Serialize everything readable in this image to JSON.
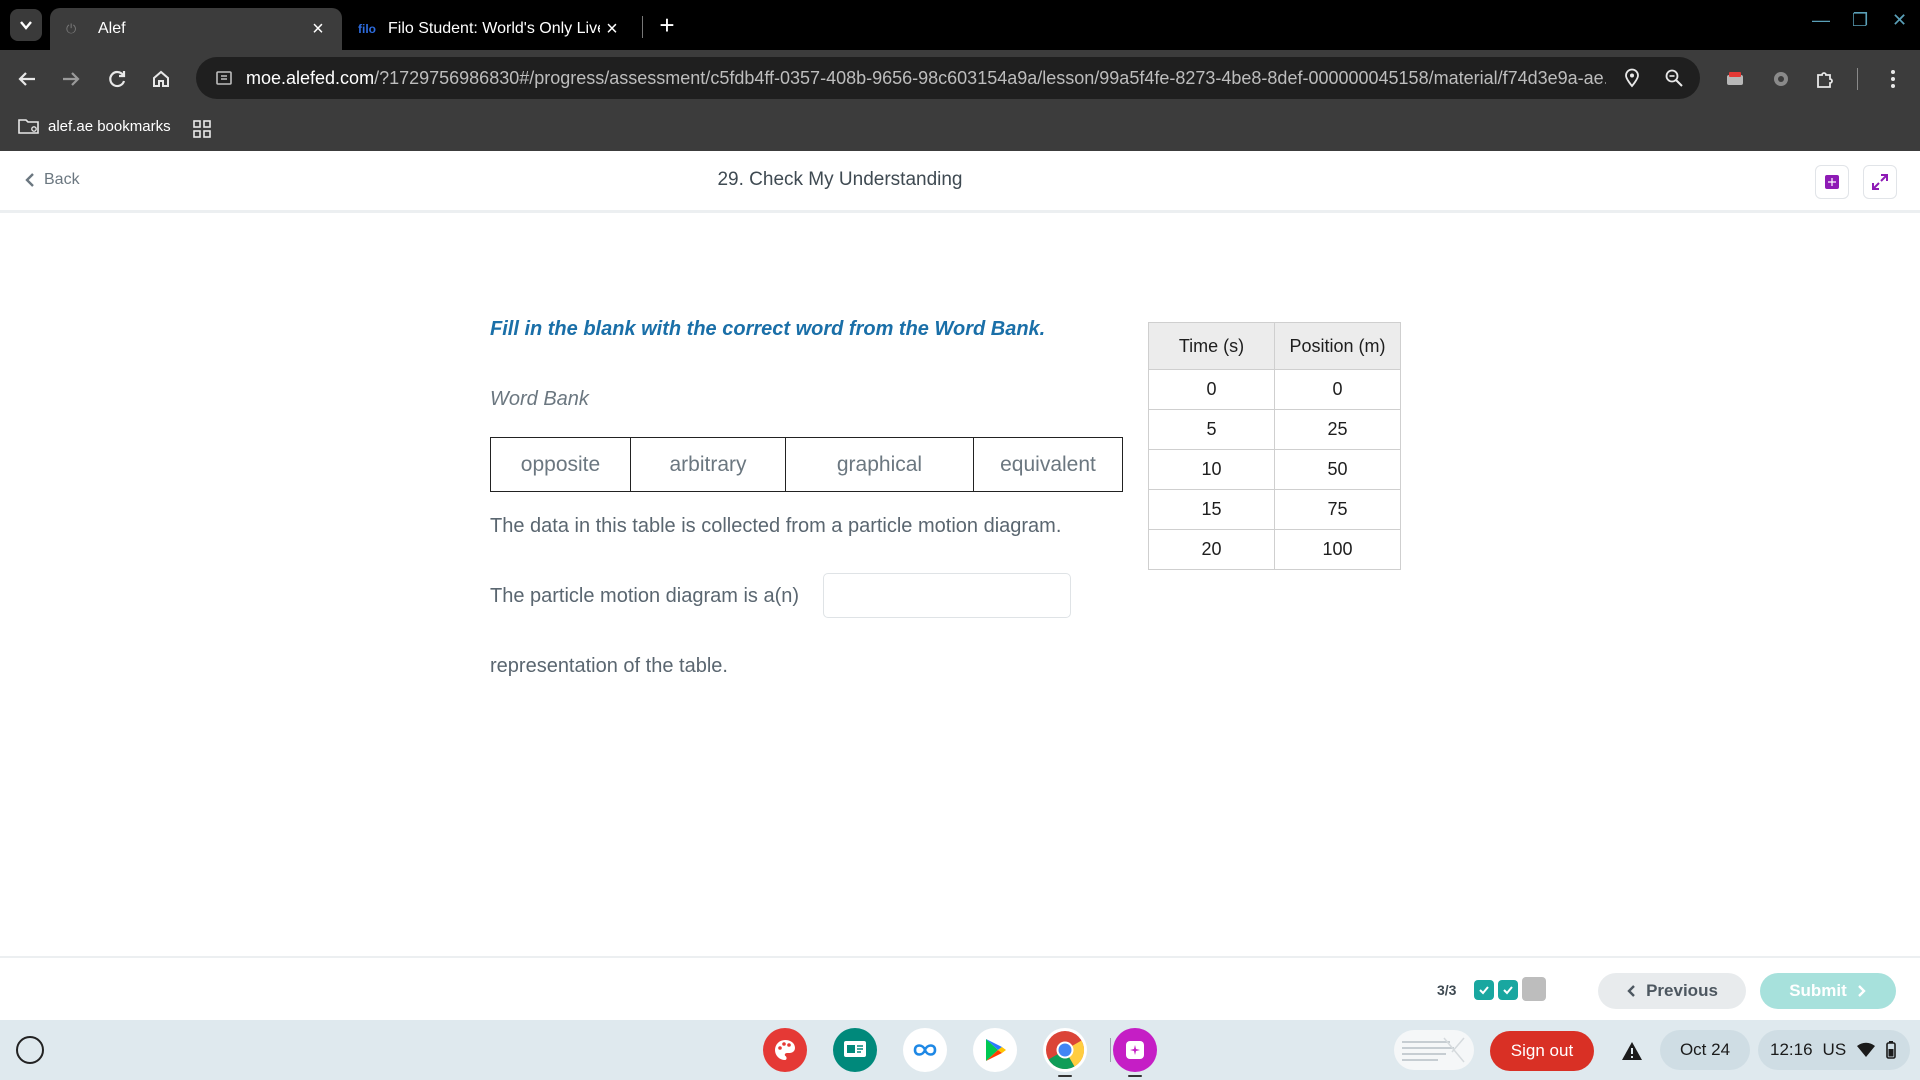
{
  "browser": {
    "tabs": [
      {
        "title": "Alef",
        "favicon": "alef-favicon",
        "active": true
      },
      {
        "title": "Filo Student: World's Only Live I",
        "favicon_text": "filo",
        "active": false
      }
    ],
    "url_host": "moe.alefed.com",
    "url_rest": "/?1729756986830#/progress/assessment/c5fdb4ff-0357-408b-9656-98c603154a9a/lesson/99a5f4fe-8273-4be8-8def-000000045158/material/f74d3e9a-ae...",
    "bookmarks": [
      {
        "label": "alef.ae bookmarks",
        "icon": "bookmark-folder-icon"
      }
    ]
  },
  "header": {
    "back_label": "Back",
    "title": "29. Check My Understanding"
  },
  "question": {
    "instruction": "Fill in the blank with the correct word from the Word Bank.",
    "word_bank_label": "Word Bank",
    "words": [
      "opposite",
      "arbitrary",
      "graphical",
      "equivalent"
    ],
    "sentence_1": "The data in this table is collected from a particle motion diagram.",
    "sentence_2": "The particle motion diagram is a(n)",
    "sentence_3": "representation of the table.",
    "blank_value": ""
  },
  "table": {
    "headers": [
      "Time (s)",
      "Position (m)"
    ],
    "rows": [
      [
        "0",
        "0"
      ],
      [
        "5",
        "25"
      ],
      [
        "10",
        "50"
      ],
      [
        "15",
        "75"
      ],
      [
        "20",
        "100"
      ]
    ]
  },
  "footer": {
    "progress": "3/3",
    "progress_states": [
      "done",
      "done",
      "current"
    ],
    "previous_label": "Previous",
    "submit_label": "Submit",
    "accent": "#19a7a0"
  },
  "shelf": {
    "apps": [
      "art-app-icon",
      "classroom-app-icon",
      "link-app-icon",
      "play-store-icon",
      "chrome-icon",
      "canvas-app-icon"
    ],
    "sign_out": "Sign out",
    "date": "Oct 24",
    "time": "12:16",
    "locale": "US"
  }
}
